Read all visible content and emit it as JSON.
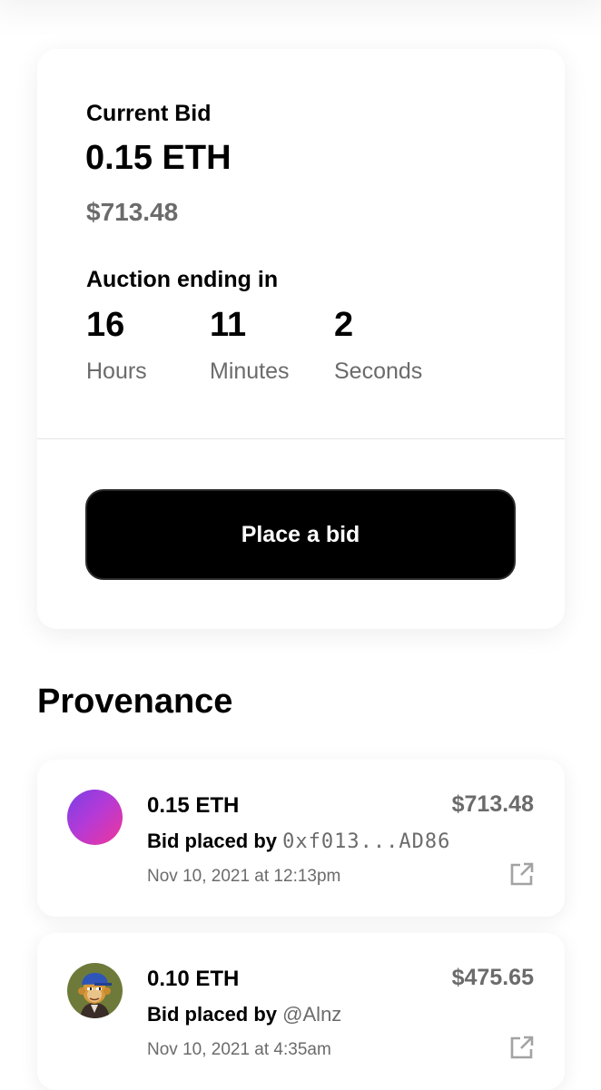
{
  "bid_card": {
    "current_bid_label": "Current Bid",
    "current_bid_eth": "0.15 ETH",
    "current_bid_usd": "$713.48",
    "auction_label": "Auction ending in",
    "countdown": [
      {
        "value": "16",
        "unit": "Hours"
      },
      {
        "value": "11",
        "unit": "Minutes"
      },
      {
        "value": "2",
        "unit": "Seconds"
      }
    ],
    "place_bid_label": "Place a bid"
  },
  "provenance": {
    "title": "Provenance",
    "entries": [
      {
        "amount": "0.15 ETH",
        "usd": "$713.48",
        "bidder_prefix": "Bid placed by",
        "bidder": "0xf013...AD86",
        "date": "Nov 10, 2021 at 12:13pm",
        "avatar": "gradient-avatar",
        "link_icon": "external-link-icon"
      },
      {
        "amount": "0.10 ETH",
        "usd": "$475.65",
        "bidder_prefix": "Bid placed by",
        "bidder": "@Alnz",
        "date": "Nov 10, 2021 at 4:35am",
        "avatar": "ape-avatar",
        "link_icon": "external-link-icon"
      }
    ]
  },
  "colors": {
    "primary_text": "#000000",
    "secondary_text": "#6b6b6b",
    "button_bg": "#000000",
    "button_text": "#ffffff",
    "avatar_gradient_start": "#7b3fe4",
    "avatar_gradient_end": "#f0369a"
  }
}
